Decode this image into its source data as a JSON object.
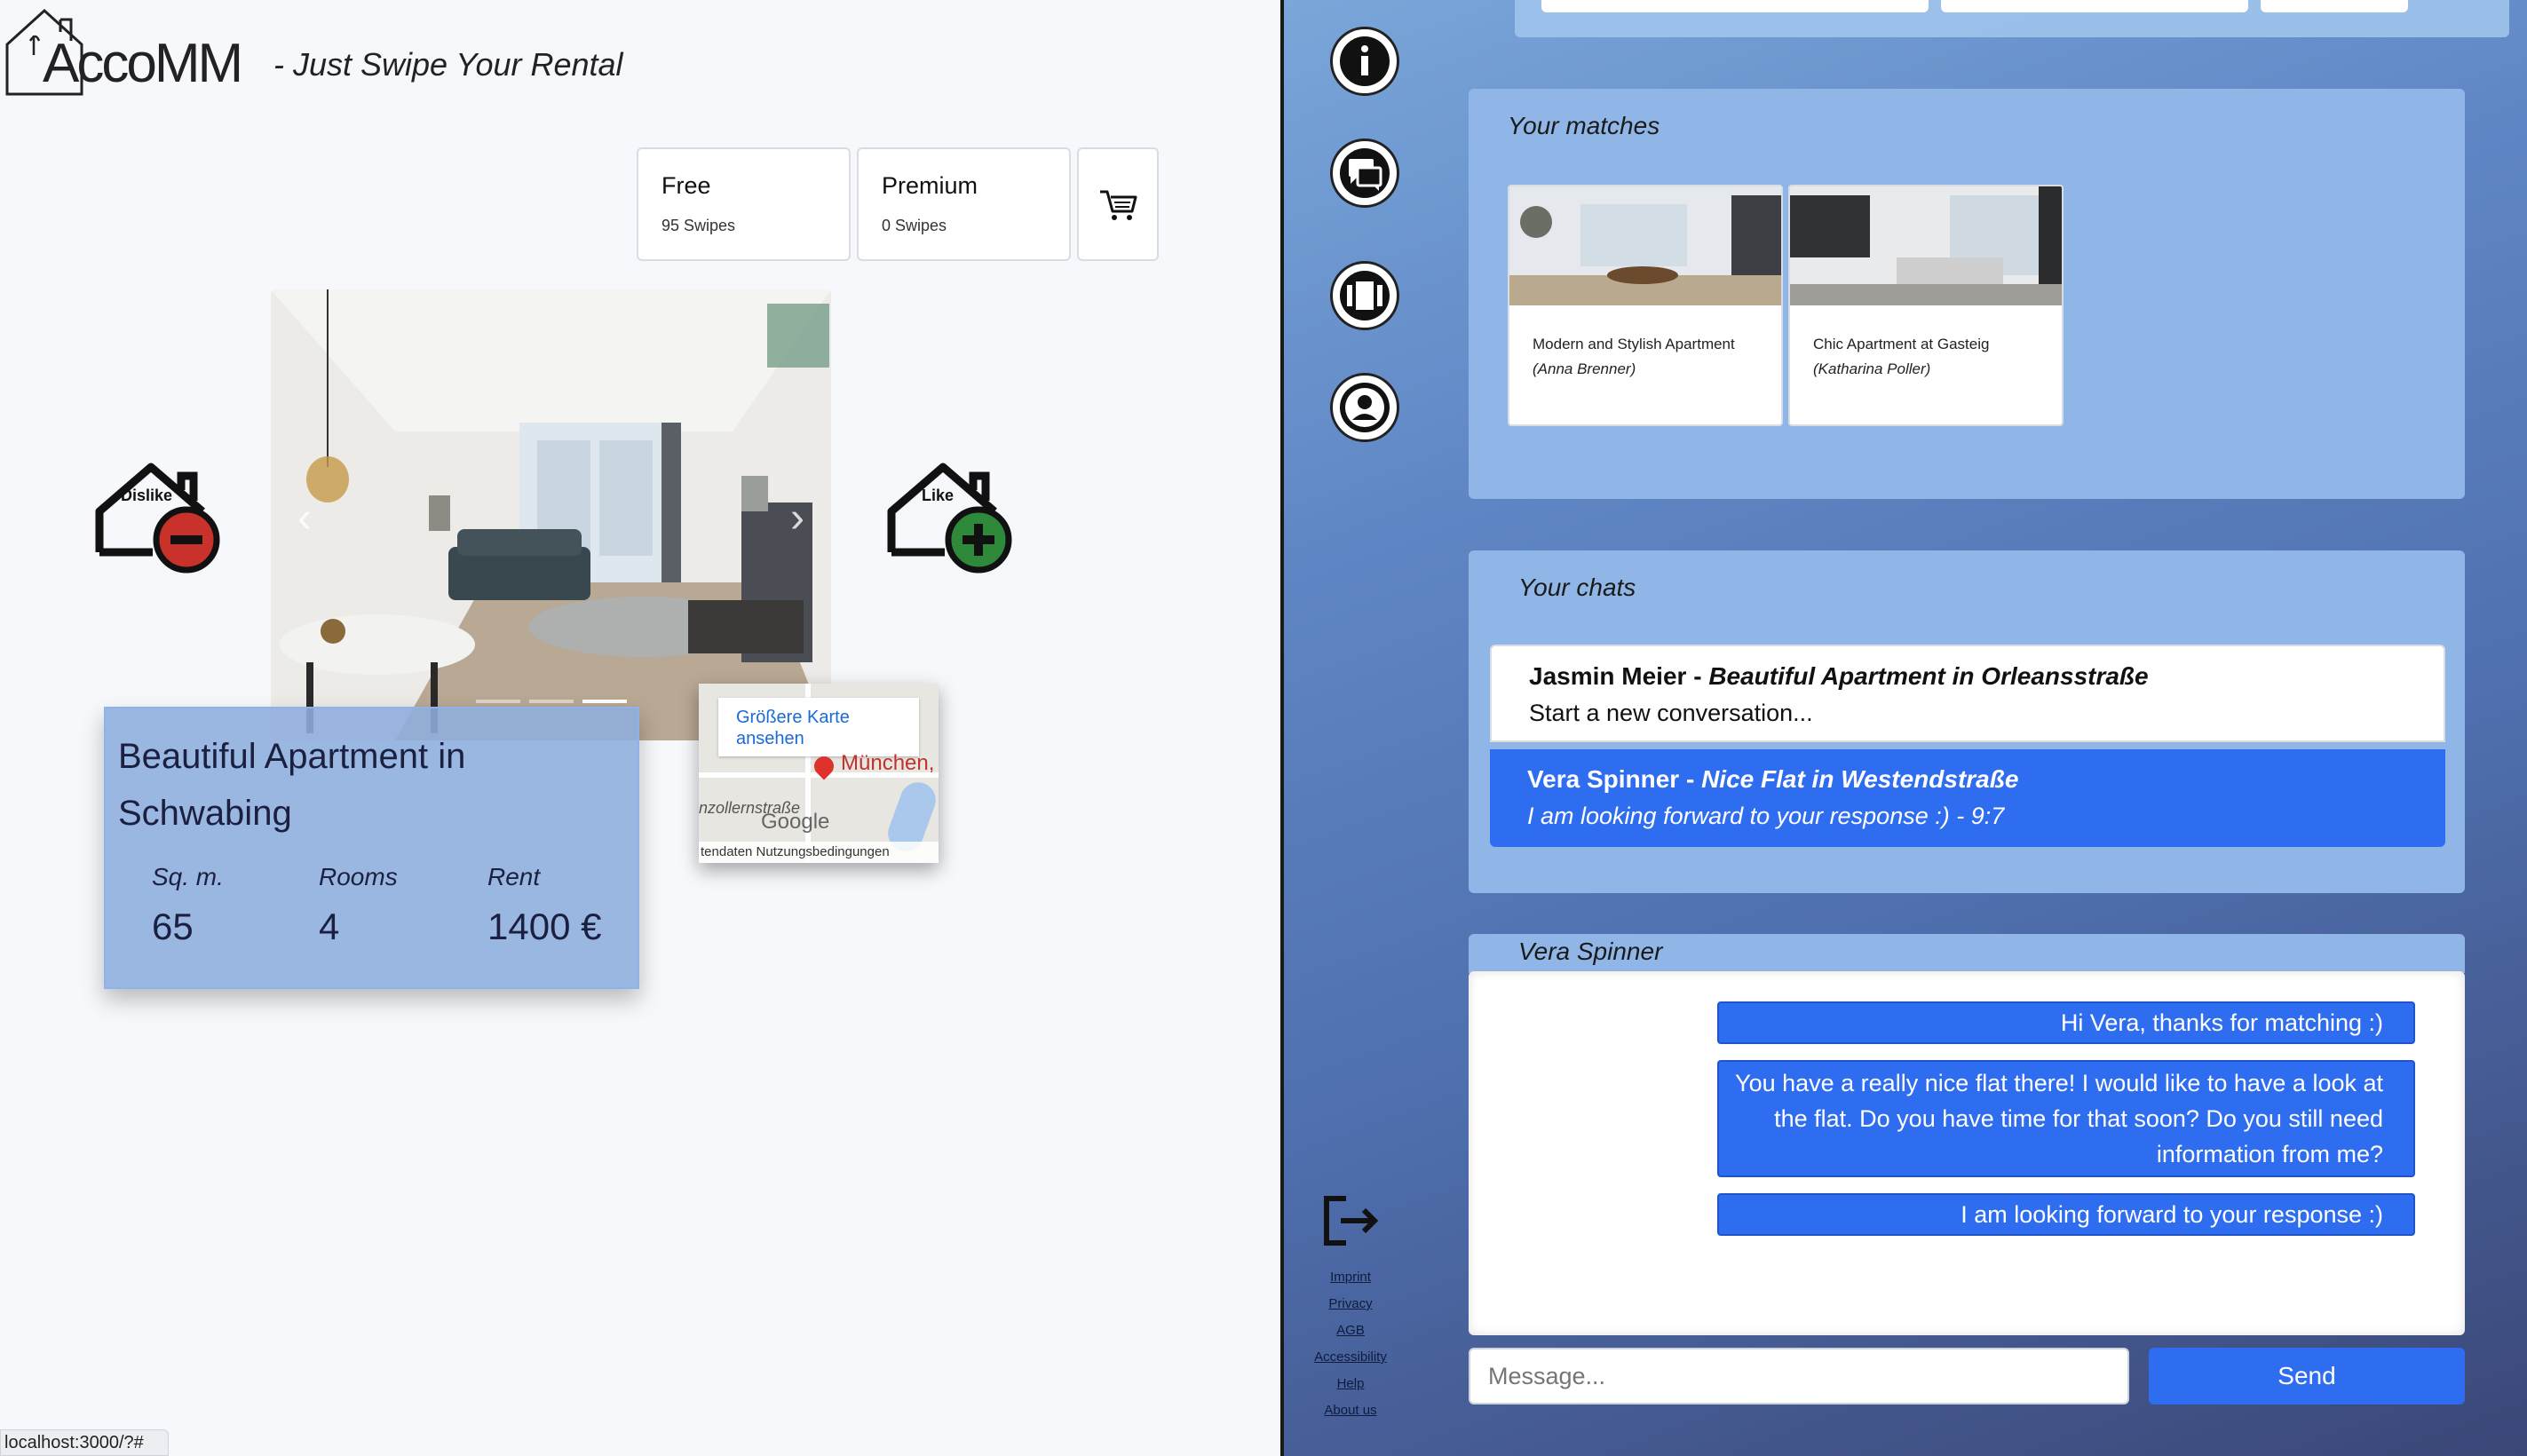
{
  "app": {
    "logo_text": "AccoMM",
    "tagline": "- Just Swipe Your Rental"
  },
  "plans": [
    {
      "name": "Free",
      "swipes": "95 Swipes"
    },
    {
      "name": "Premium",
      "swipes": "0 Swipes"
    }
  ],
  "swipe": {
    "dislike_label": "Dislike",
    "like_label": "Like"
  },
  "listing": {
    "title": "Beautiful Apartment in Schwabing",
    "stats": [
      {
        "label": "Sq. m.",
        "value": "65"
      },
      {
        "label": "Rooms",
        "value": "4"
      },
      {
        "label": "Rent",
        "value": "1400 €"
      }
    ]
  },
  "map": {
    "link_text": "Größere Karte ansehen",
    "city": "München,",
    "street": "nzollernstraße",
    "logo": "Google",
    "footer": "tendaten  Nutzungsbedingungen"
  },
  "status_bar": "localhost:3000/?#",
  "sidebar": {
    "icons": [
      "info-icon",
      "chats-icon",
      "carousel-icon",
      "profile-icon"
    ],
    "footer_links": [
      "Imprint",
      "Privacy",
      "AGB",
      "Accessibility",
      "Help",
      "About us"
    ]
  },
  "matches": {
    "title": "Your matches",
    "items": [
      {
        "title": "Modern and Stylish Apartment",
        "owner": "(Anna Brenner)"
      },
      {
        "title": "Chic Apartment at Gasteig",
        "owner": "(Katharina Poller)"
      }
    ]
  },
  "chats": {
    "title": "Your chats",
    "items": [
      {
        "name": "Jasmin Meier",
        "listing": "Beautiful Apartment in Orleansstraße",
        "last": "Start a new conversation..."
      },
      {
        "name": "Vera Spinner",
        "listing": "Nice Flat in Westendstraße",
        "last": "I am looking forward to your response :) - 9:7"
      }
    ]
  },
  "conversation": {
    "partner": "Vera Spinner",
    "messages": [
      "Hi Vera, thanks for matching :)",
      "You have a really nice flat there! I would like to have a look at the flat. Do you have time for that soon? Do you still need information from me?",
      "I am looking forward to your response :)"
    ],
    "input_placeholder": "Message...",
    "send_label": "Send"
  },
  "colors": {
    "accent_blue": "#2e6df0",
    "panel_blue": "#8fb6e6",
    "dislike_red": "#c9312b",
    "like_green": "#2e8a3a"
  }
}
